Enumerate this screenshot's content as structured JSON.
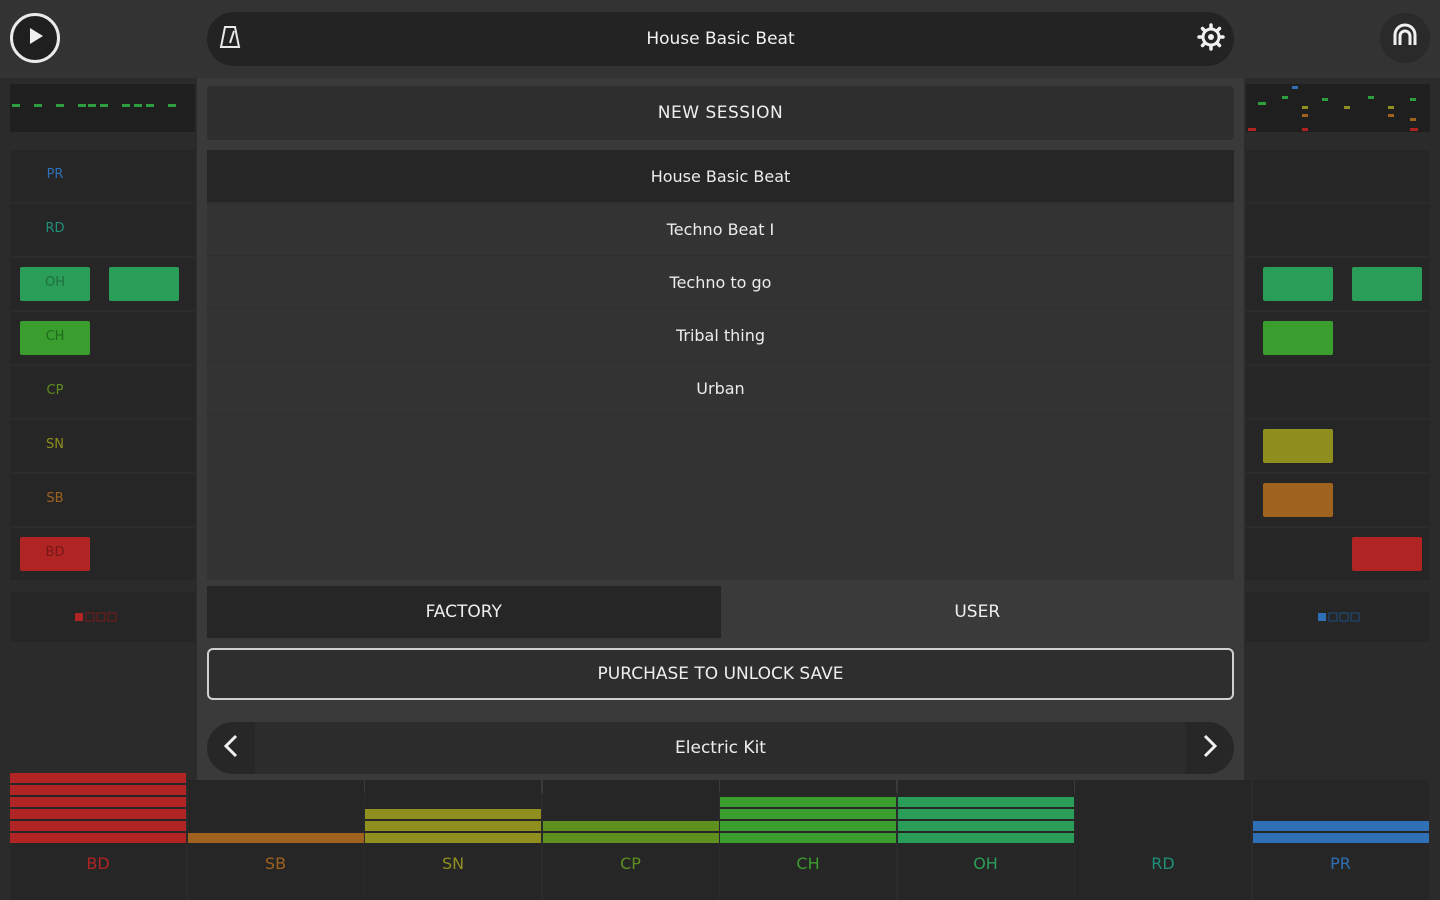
{
  "header": {
    "title": "House Basic Beat",
    "play_icon": "play-icon",
    "metronome_icon": "metronome-icon",
    "settings_icon": "gear-icon",
    "headphone_icon": "headphones-icon"
  },
  "lanes": [
    {
      "label": "PR",
      "color": "#2e6fb5"
    },
    {
      "label": "RD",
      "color": "#1f8f7a"
    },
    {
      "label": "OH",
      "color": "#2a9e58"
    },
    {
      "label": "CH",
      "color": "#3a9e2e"
    },
    {
      "label": "CP",
      "color": "#5e8f1f"
    },
    {
      "label": "SN",
      "color": "#8f8f1f"
    },
    {
      "label": "SB",
      "color": "#a0621f"
    },
    {
      "label": "BD",
      "color": "#b02424"
    }
  ],
  "session": {
    "new_session_label": "NEW SESSION",
    "items": [
      {
        "label": "House Basic Beat",
        "selected": true
      },
      {
        "label": "Techno Beat I",
        "selected": false
      },
      {
        "label": "Techno to go",
        "selected": false
      },
      {
        "label": "Tribal thing",
        "selected": false
      },
      {
        "label": "Urban",
        "selected": false
      }
    ]
  },
  "tabs": [
    {
      "label": "FACTORY",
      "active": true
    },
    {
      "label": "USER",
      "active": false
    }
  ],
  "purchase_label": "PURCHASE TO UNLOCK SAVE",
  "kit": {
    "name": "Electric Kit",
    "prev_icon": "chevron-left-icon",
    "next_icon": "chevron-right-icon"
  },
  "mixer": {
    "channels": [
      {
        "label": "BD",
        "color": "#b02424",
        "level": 6
      },
      {
        "label": "SB",
        "color": "#a0621f",
        "level": 1
      },
      {
        "label": "SN",
        "color": "#8f8f1f",
        "level": 3
      },
      {
        "label": "CP",
        "color": "#5e8f1f",
        "level": 2
      },
      {
        "label": "CH",
        "color": "#3a9e2e",
        "level": 4
      },
      {
        "label": "OH",
        "color": "#2a9e58",
        "level": 4
      },
      {
        "label": "RD",
        "color": "#1f8f7a",
        "level": 0
      },
      {
        "label": "PR",
        "color": "#2e6fb5",
        "level": 2
      }
    ]
  }
}
